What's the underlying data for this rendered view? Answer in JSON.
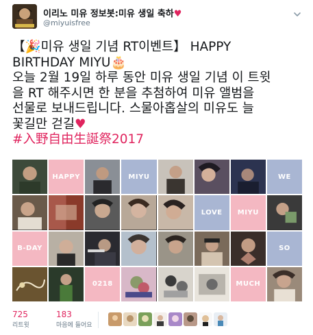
{
  "header": {
    "display_name": "이리노 미유 정보봇:미유 생일 축하",
    "heart": "♥",
    "handle": "@miyuisfree"
  },
  "tweet": {
    "line1_prefix": "【",
    "party_emoji": "🎉",
    "line1_rest": "미유 생일 기념 RT이벤트】 HAPPY",
    "line2": "BIRTHDAY MIYU",
    "cake_emoji": "🎂",
    "line3": "오늘 2월 19일 하루 동안 미유 생일 기념 이 트윗",
    "line4": "을 RT 해주시면 한 분을 추첨하여 미유 앨범을",
    "line5": "선물로 보내드립니다. 스물아홉살의 미유도 늘",
    "line6": "꽃길만 걷길",
    "heart": "♥",
    "hashtag": "#入野自由生誕祭2017"
  },
  "grid_labels": {
    "happy": "HAPPY",
    "miyu1": "MIYU",
    "we": "WE",
    "love": "LOVE",
    "miyu2": "MIYU",
    "bday": "B-DAY",
    "so": "SO",
    "date": "0218",
    "much": "MUCH"
  },
  "stats": {
    "retweets_count": "725",
    "retweets_label": "리트윗",
    "likes_count": "183",
    "likes_label": "마음에 들어요"
  },
  "colors": {
    "pink_tile": "#f4b8c2",
    "blue_tile": "#a9b6d3",
    "stat_accent": "#e0245e",
    "hashtag": "#e0245e"
  }
}
